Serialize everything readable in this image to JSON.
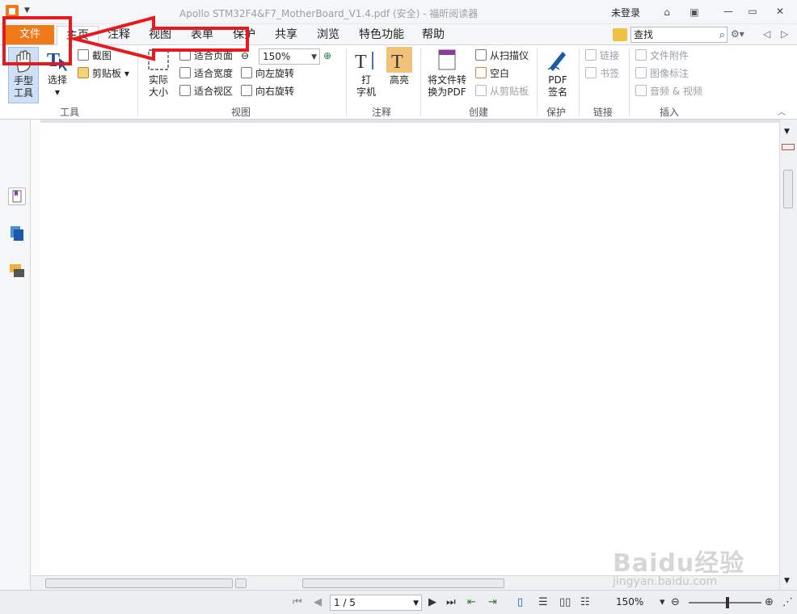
{
  "window": {
    "title": "Apollo STM32F4&F7_MotherBoard_V1.4.pdf (安全) - 福昕阅读器",
    "login": "未登录"
  },
  "menu": {
    "file": "文件",
    "tabs": [
      "主页",
      "注释",
      "视图",
      "表单",
      "保护",
      "共享",
      "浏览",
      "特色功能",
      "帮助"
    ],
    "search_placeholder": "查找"
  },
  "ribbon": {
    "tools": {
      "hand_line1": "手型",
      "hand_line2": "工具",
      "select": "选择",
      "snapshot": "截图",
      "clipboard": "剪贴板",
      "group": "工具"
    },
    "view": {
      "actual_line1": "实际",
      "actual_line2": "大小",
      "fit_page": "适合页面",
      "fit_width": "适合宽度",
      "fit_visible": "适合视区",
      "zoom": "150%",
      "rotate_left": "向左旋转",
      "rotate_right": "向右旋转",
      "group": "视图"
    },
    "comment": {
      "typewriter_line1": "打",
      "typewriter_line2": "字机",
      "highlight": "高亮",
      "group": "注释"
    },
    "create": {
      "convert_line1": "将文件转",
      "convert_line2": "换为PDF",
      "from_scanner": "从扫描仪",
      "blank": "空白",
      "from_clipboard": "从剪贴板",
      "group": "创建"
    },
    "protect": {
      "sign_line1": "PDF",
      "sign_line2": "签名",
      "group": "保护"
    },
    "links": {
      "link": "链接",
      "bookmark": "书签",
      "group": "链接"
    },
    "insert": {
      "attachment": "文件附件",
      "image_mark": "图像标注",
      "audio_video": "音频 & 视频",
      "group": "插入"
    }
  },
  "status": {
    "page": "1 / 5",
    "zoom": "150%"
  },
  "watermark": {
    "main": "Baidu经验",
    "sub": "jingyan.baidu.com"
  },
  "colors": {
    "accent": "#f07a1a",
    "annotation": "#e8191e"
  }
}
